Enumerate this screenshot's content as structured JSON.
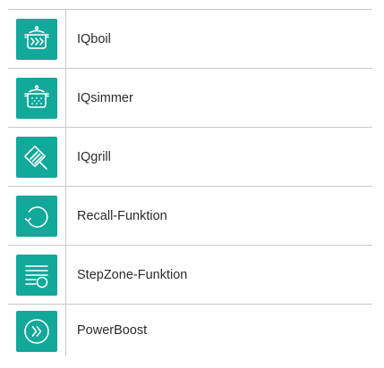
{
  "colors": {
    "accent": "#12a89a",
    "icon_stroke": "#ffffff",
    "border": "#c8c8c8",
    "text": "#2b2b2b"
  },
  "features": [
    {
      "label": "IQboil",
      "icon": "pot-boil-icon"
    },
    {
      "label": "IQsimmer",
      "icon": "pot-simmer-icon"
    },
    {
      "label": "IQgrill",
      "icon": "grill-icon"
    },
    {
      "label": "Recall-Funktion",
      "icon": "recall-icon"
    },
    {
      "label": "StepZone-Funktion",
      "icon": "stepzone-icon"
    },
    {
      "label": "PowerBoost",
      "icon": "powerboost-icon"
    }
  ]
}
